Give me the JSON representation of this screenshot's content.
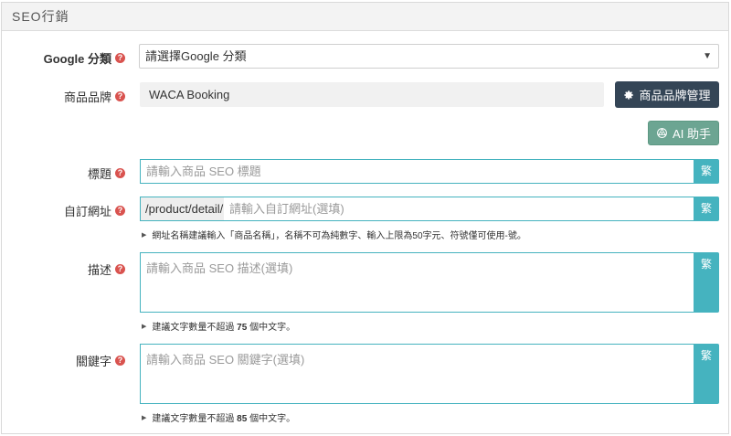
{
  "section": {
    "title": "SEO行銷"
  },
  "google_category": {
    "label": "Google 分類",
    "value": "請選擇Google 分類"
  },
  "brand": {
    "label": "商品品牌",
    "value": "WACA Booking",
    "manage_button": "商品品牌管理"
  },
  "ai_button": {
    "label": "AI 助手"
  },
  "title_field": {
    "label": "標題",
    "placeholder": "請輸入商品 SEO 標題",
    "convert_button": "繁"
  },
  "url_field": {
    "label": "自訂網址",
    "prefix": "/product/detail/",
    "placeholder": "請輸入自訂網址(選填)",
    "convert_button": "繁",
    "hint": "網址名稱建議輸入「商品名稱」，名稱不可為純數字、輸入上限為50字元、符號僅可使用-號。"
  },
  "description_field": {
    "label": "描述",
    "placeholder": "請輸入商品 SEO 描述(選填)",
    "convert_button": "繁",
    "hint_before": "建議文字數量不超過",
    "hint_number": "75",
    "hint_after": "個中文字。"
  },
  "keyword_field": {
    "label": "關鍵字",
    "placeholder": "請輸入商品 SEO 關鍵字(選填)",
    "convert_button": "繁",
    "hint_before": "建議文字數量不超過",
    "hint_number": "85",
    "hint_after": "個中文字。"
  },
  "icons": {
    "help": "question-circle-icon",
    "gear": "gear-icon",
    "ai": "openai-icon",
    "caret": "caret-down-icon",
    "hint_arrow": "triangle-right-icon"
  },
  "colors": {
    "accent": "#45b3bf",
    "dark_button": "#344556",
    "ai_button": "#6ca592",
    "help_icon": "#d9534f"
  }
}
